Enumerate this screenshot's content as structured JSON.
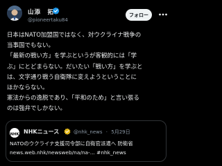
{
  "post": {
    "author": {
      "display_name": "山添　拓",
      "handle": "@pioneertaku84",
      "verified": true
    },
    "follow_label": "フォロー",
    "more_icon": "more-icon",
    "lines": [
      "日本はNATO加盟国ではなく、対ウクライナ戦争の",
      "当事国でもない。",
      "「最新の戦い方」を学ぶというが客観的には「学",
      "ぶ」にとどまらない。だいたい「戦い方」を学ぶと",
      "は、文字通り戦う自衛隊に変えようということに",
      "ほかならない。",
      "憲法からの逸脱であり、「平和のため」と言い張る",
      "のは強弁でしかない。"
    ]
  },
  "quote": {
    "display_name": "NHKニュース",
    "verified": true,
    "handle": "@nhk_news",
    "separator": "·",
    "date": "5月29日",
    "lines": [
      "NATOのウクライナ支援司令部に自衛官派遣へ 防衛省",
      "news.web.nhk/newsweb/na/na-... #nhk_news"
    ]
  },
  "colors": {
    "background": "#000000",
    "text": "#e7e9ea",
    "muted": "#8b98a5",
    "verified_blue": "#1d9bf0",
    "verified_gold": "#e2b719",
    "follow_bg": "#eff3f4"
  }
}
